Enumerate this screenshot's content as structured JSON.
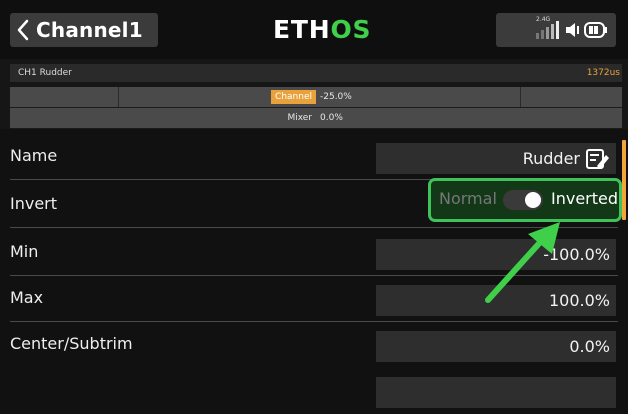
{
  "header": {
    "title": "Channel1",
    "brand_primary": "ETH",
    "brand_accent": "OS",
    "signal_label": "2.4G",
    "accent_color": "#3fcf4a",
    "icons": [
      "chevron-left-icon",
      "signal-icon",
      "speaker-icon",
      "battery-icon"
    ]
  },
  "monitor": {
    "channel_name": "CH1 Rudder",
    "pulse": "1372us",
    "channel_label": "Channel",
    "channel_value": "-25.0%",
    "mixer_label": "Mixer",
    "mixer_value": "0.0%",
    "highlight_color": "#e9a23b"
  },
  "rows": {
    "name": {
      "label": "Name",
      "value": "Rudder",
      "icon": "edit-icon"
    },
    "invert": {
      "label": "Invert",
      "off_label": "Normal",
      "on_label": "Inverted",
      "state": "on",
      "highlight_color": "#40c25a"
    },
    "min": {
      "label": "Min",
      "value": "-100.0%"
    },
    "max": {
      "label": "Max",
      "value": "100.0%"
    },
    "center": {
      "label": "Center/Subtrim",
      "value": "0.0%"
    }
  }
}
